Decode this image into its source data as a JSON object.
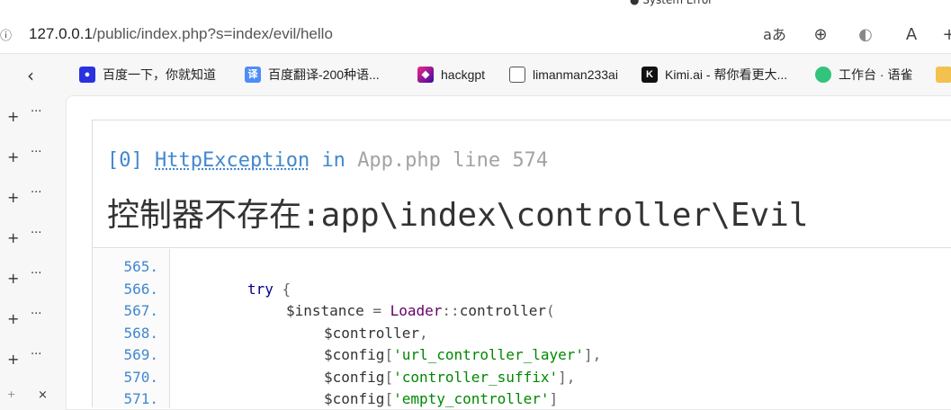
{
  "browser": {
    "url_host": "127.0.0.1",
    "url_path": "/public/index.php?s=index/evil/hello",
    "toolbar_icons": [
      "read-aloud-icon",
      "zoom-icon",
      "copilot-icon",
      "reader-icon",
      "plus-icon"
    ]
  },
  "bookmarks": [
    {
      "label": "百度一下，你就知道",
      "icon": "baidu-icon",
      "color": "#2932e1"
    },
    {
      "label": "百度翻译-200种语...",
      "icon": "translate-icon",
      "color": "#4e8cf7"
    },
    {
      "label": "hackgpt",
      "icon": "hackgpt-icon",
      "color": "#7b2ff7"
    },
    {
      "label": "limanman233ai",
      "icon": "document-icon",
      "color": "#ffffff"
    },
    {
      "label": "Kimi.ai - 帮你看更大...",
      "icon": "kimi-icon",
      "color": "#111111"
    },
    {
      "label": "工作台 · 语雀",
      "icon": "yuque-icon",
      "color": "#31c47a"
    }
  ],
  "exception": {
    "index": "[0]",
    "class": "HttpException",
    "in_word": "in",
    "location": "App.php line 574",
    "message": "控制器不存在:app\\index\\controller\\Evil"
  },
  "code_lines": [
    {
      "num": "565.",
      "text": ""
    },
    {
      "num": "566.",
      "text": "try {"
    },
    {
      "num": "567.",
      "text": "$instance = Loader::controller("
    },
    {
      "num": "568.",
      "text": "$controller,"
    },
    {
      "num": "569.",
      "text": "$config['url_controller_layer'],"
    },
    {
      "num": "570.",
      "text": "$config['controller_suffix'],"
    },
    {
      "num": "571.",
      "text": "$config['empty_controller']"
    }
  ],
  "colors": {
    "link_blue": "#4288ce",
    "keyword": "#000088",
    "string": "#008800",
    "class_name": "#660066"
  }
}
